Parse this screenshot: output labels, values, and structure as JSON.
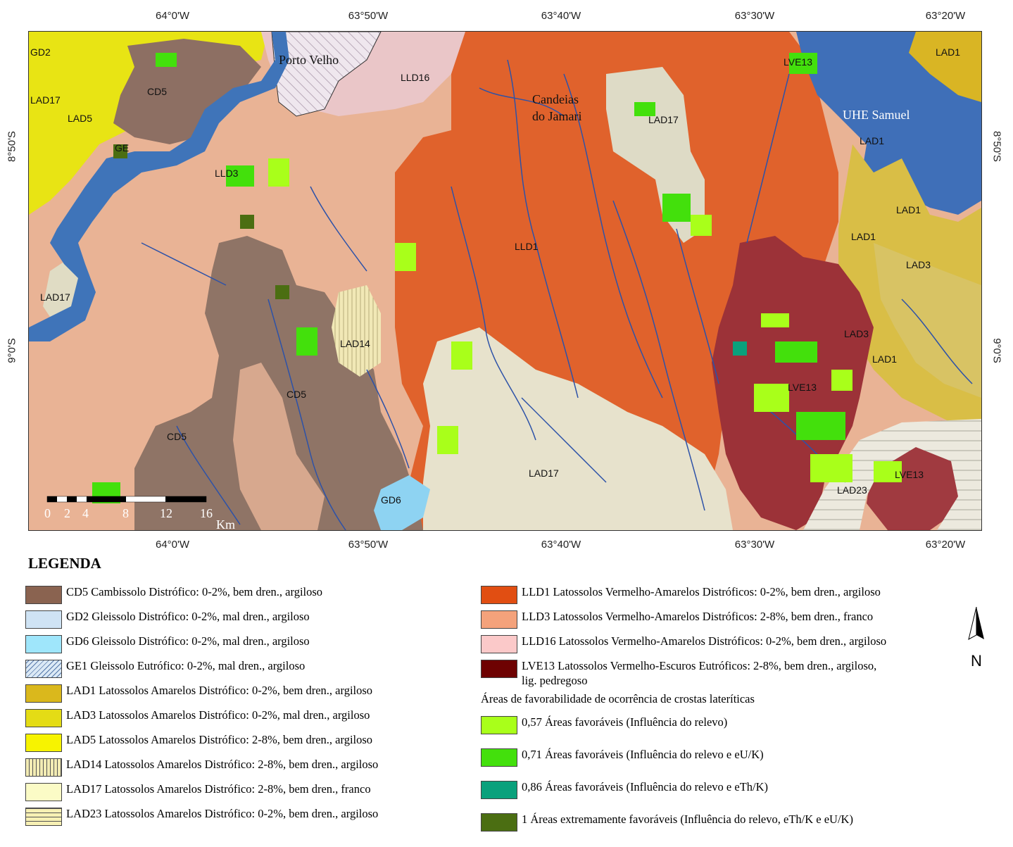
{
  "map": {
    "coord_labels": {
      "top": [
        "64°0'W",
        "63°50'W",
        "63°40'W",
        "63°30'W",
        "63°20'W"
      ],
      "bottom": [
        "64°0'W",
        "63°50'W",
        "63°40'W",
        "63°30'W",
        "63°20'W"
      ],
      "left": [
        "8°50'S",
        "9°0'S"
      ],
      "right": [
        "8°50'S",
        "9°0'S"
      ]
    },
    "place_names": {
      "porto_velho": "Porto Velho",
      "candeias_1": "Candeias",
      "candeias_2": "do Jamari",
      "uhe_samuel": "UHE Samuel"
    },
    "unit_labels": {
      "gd2": "GD2",
      "lad17_a": "LAD17",
      "lad5": "LAD5",
      "cd5_a": "CD5",
      "ge": "GE",
      "lld3": "LLD3",
      "lad17_b": "LAD17",
      "lld16": "LLD16",
      "lad14": "LAD14",
      "cd5_b": "CD5",
      "cd5_c": "CD5",
      "gd6": "GD6",
      "lld1": "LLD1",
      "lad17_c": "LAD17",
      "lad17_d": "LAD17",
      "lve13_a": "LVE13",
      "lve13_b": "LVE13",
      "lve13_c": "LVE13",
      "lad1_a": "LAD1",
      "lad1_b": "LAD1",
      "lad1_c": "LAD1",
      "lad1_d": "LAD1",
      "lad1_e": "LAD1",
      "lad3_a": "LAD3",
      "lad3_b": "LAD3",
      "lad23": "LAD23"
    },
    "scale_bar": {
      "ticks": [
        "0",
        "2",
        "4",
        "8",
        "12",
        "16"
      ],
      "unit": "Km"
    },
    "north_label": "N"
  },
  "legend": {
    "title": "LEGENDA",
    "left_items": [
      {
        "key": "cd5",
        "label": "CD5 Cambissolo Distrófico: 0-2%, bem dren., argiloso",
        "color": "#8a6350"
      },
      {
        "key": "gd2",
        "label": "GD2 Gleissolo Distrófico: 0-2%, mal dren., argiloso",
        "color": "#cfe3f4"
      },
      {
        "key": "gd6",
        "label": "GD6 Gleissolo Distrófico: 0-2%, mal dren., argiloso",
        "color": "#9fe6fb"
      },
      {
        "key": "ge1",
        "label": "GE1 Gleissolo Eutrófico: 0-2%, mal dren., argiloso",
        "color": "#dbe9f5"
      },
      {
        "key": "lad1",
        "label": "LAD1 Latossolos Amarelos Distrófico: 0-2%, bem dren., argiloso",
        "color": "#dab81c"
      },
      {
        "key": "lad3",
        "label": "LAD3 Latossolos Amarelos Distrófico: 0-2%, mal dren., argiloso",
        "color": "#e4dc15"
      },
      {
        "key": "lad5",
        "label": "LAD5 Latossolos Amarelos Distrófico: 2-8%, bem dren., argiloso",
        "color": "#f7f300"
      },
      {
        "key": "lad14",
        "label": "LAD14 Latossolos Amarelos Distrófico: 2-8%, bem dren., argiloso",
        "color": "#f3ecb4"
      },
      {
        "key": "lad17",
        "label": "LAD17 Latossolos Amarelos Distrófico: 2-8%, bem dren., franco",
        "color": "#fbfbc6"
      },
      {
        "key": "lad23",
        "label": "LAD23 Latossolos Amarelos Distrófico: 0-2%, bem dren., argiloso",
        "color": "#f7f0b4"
      }
    ],
    "right_items": [
      {
        "key": "lld1",
        "label": "LLD1 Latossolos Vermelho-Amarelos Distróficos: 0-2%, bem dren., argiloso",
        "color": "#e14e12"
      },
      {
        "key": "lld3",
        "label": "LLD3 Latossolos Vermelho-Amarelos Distróficos: 2-8%, bem dren., franco",
        "color": "#f4a27b"
      },
      {
        "key": "lld16",
        "label": "LLD16 Latossolos Vermelho-Amarelos Distróficos: 0-2%, bem dren., argiloso",
        "color": "#fbc9c9"
      },
      {
        "key": "lve13",
        "label": "LVE13 Latossolos Vermelho-Escuros Eutróficos: 2-8%, bem dren., argiloso,",
        "label2": "lig. pedregoso",
        "color": "#6e0202"
      }
    ],
    "favorability_title": "Áreas de favorabilidade de ocorrência de crostas lateríticas",
    "favorability_items": [
      {
        "key": "f057",
        "label": "0,57 Áreas favoráveis (Influência do relevo)",
        "color": "#a9ff1a"
      },
      {
        "key": "f071",
        "label": "0,71 Áreas favoráveis (Influência do relevo e eU/K)",
        "color": "#43e00c"
      },
      {
        "key": "f086",
        "label": "0,86 Áreas favoráveis  (Influência do relevo e eTh/K)",
        "color": "#0aa17c"
      },
      {
        "key": "f1",
        "label": "1 Áreas extremamente favoráveis  (Influência do relevo, eTh/K e eU/K)",
        "color": "#4b6e12"
      }
    ]
  }
}
